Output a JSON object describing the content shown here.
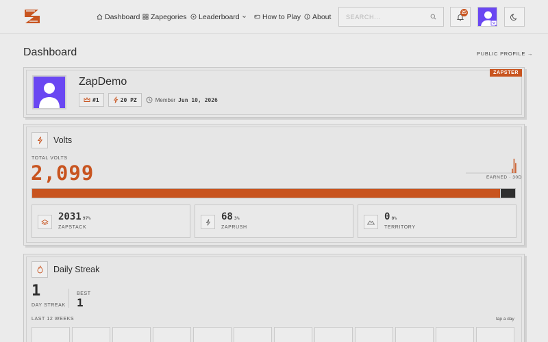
{
  "nav": {
    "dashboard": "Dashboard",
    "zapegories": "Zapegories",
    "leaderboard": "Leaderboard",
    "how_to_play": "How to Play",
    "about": "About"
  },
  "search": {
    "placeholder": "SEARCH..."
  },
  "notifications": {
    "count": "25"
  },
  "page": {
    "title": "Dashboard",
    "public_profile": "PUBLIC PROFILE →"
  },
  "profile": {
    "username": "ZapDemo",
    "tag": "ZAPSTER",
    "rank": "#1",
    "zap_points": "20 PZ",
    "member_label": "Member",
    "member_date": "Jun 10, 2026"
  },
  "volts": {
    "title": "Volts",
    "total_label": "TOTAL VOLTS",
    "total": "2,099",
    "earned_label": "EARNED · 30D",
    "bar_fill_fraction": 0.97,
    "spark_values": [
      0,
      0,
      0,
      0,
      0,
      0,
      0,
      0,
      0,
      0,
      0,
      0,
      0,
      0,
      0,
      0,
      0,
      0,
      0,
      0,
      0,
      0,
      0,
      0,
      0,
      0,
      0,
      6,
      20,
      14
    ]
  },
  "stats": [
    {
      "value": "2031",
      "pct": "97%",
      "label": "ZAPSTACK",
      "icon": "stack-icon"
    },
    {
      "value": "68",
      "pct": "3%",
      "label": "ZAPRUSH",
      "icon": "bolt-icon"
    },
    {
      "value": "0",
      "pct": "0%",
      "label": "TERRITORY",
      "icon": "mountain-icon"
    }
  ],
  "streak": {
    "title": "Daily Streak",
    "current": "1",
    "current_label": "DAY STREAK",
    "best_label": "BEST",
    "best": "1",
    "weeks_label": "LAST 12 WEEKS",
    "hint": "tap a day"
  },
  "colors": {
    "accent": "#c8541f",
    "avatar": "#6a47f2",
    "bar_track": "#2f2f2f"
  }
}
